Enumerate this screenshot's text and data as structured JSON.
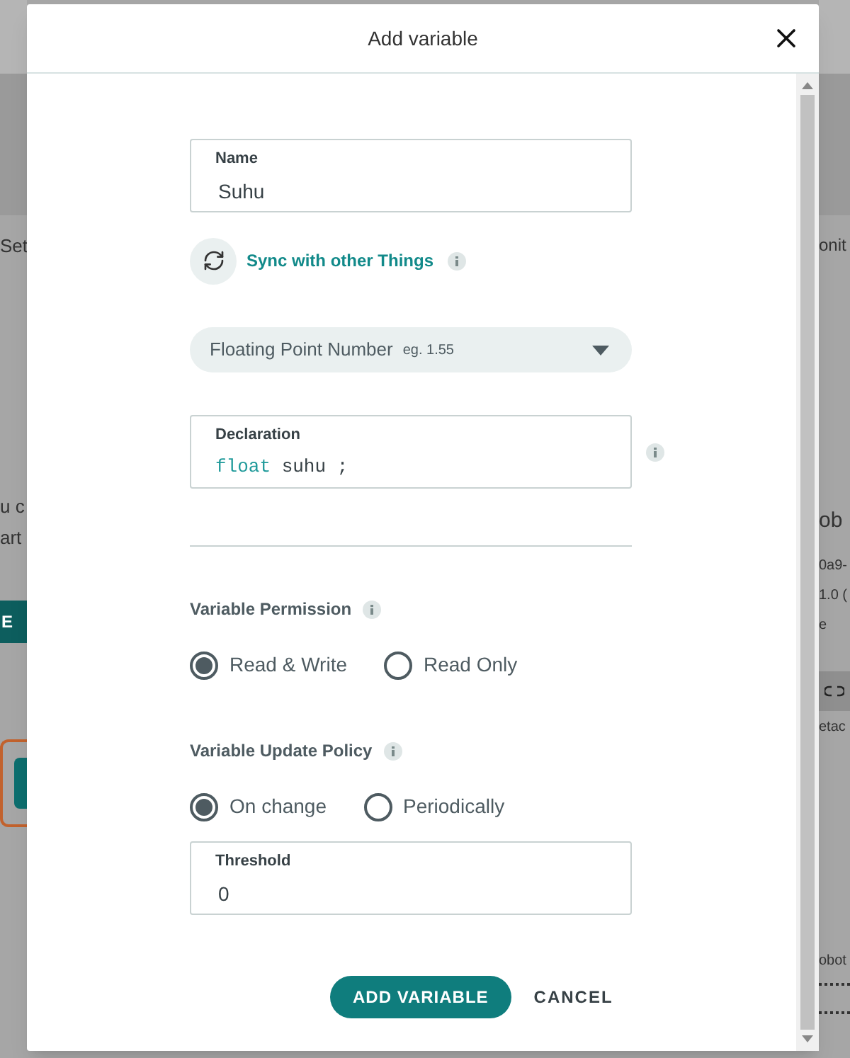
{
  "background": {
    "left": {
      "tab": "Set",
      "text_lines": [
        "u c",
        "art"
      ],
      "button": "E"
    },
    "right": {
      "tab": "onit",
      "heading": "ob",
      "details": [
        "0a9-",
        "1.0 (",
        "e"
      ],
      "link_note": "etac",
      "footer": "obot"
    }
  },
  "dialog": {
    "title": "Add variable",
    "name_field": {
      "label": "Name",
      "value": "Suhu"
    },
    "sync": {
      "label": "Sync with other Things"
    },
    "type_select": {
      "value": "Floating Point Number",
      "hint": "eg. 1.55"
    },
    "declaration": {
      "label": "Declaration",
      "keyword": "float",
      "identifier": "suhu",
      "terminator": ";"
    },
    "permission": {
      "title": "Variable Permission",
      "options": [
        {
          "label": "Read & Write",
          "selected": true
        },
        {
          "label": "Read Only",
          "selected": false
        }
      ]
    },
    "update_policy": {
      "title": "Variable Update Policy",
      "options": [
        {
          "label": "On change",
          "selected": true
        },
        {
          "label": "Periodically",
          "selected": false
        }
      ]
    },
    "threshold": {
      "label": "Threshold",
      "value": "0"
    },
    "buttons": {
      "primary": "ADD VARIABLE",
      "secondary": "CANCEL"
    }
  }
}
